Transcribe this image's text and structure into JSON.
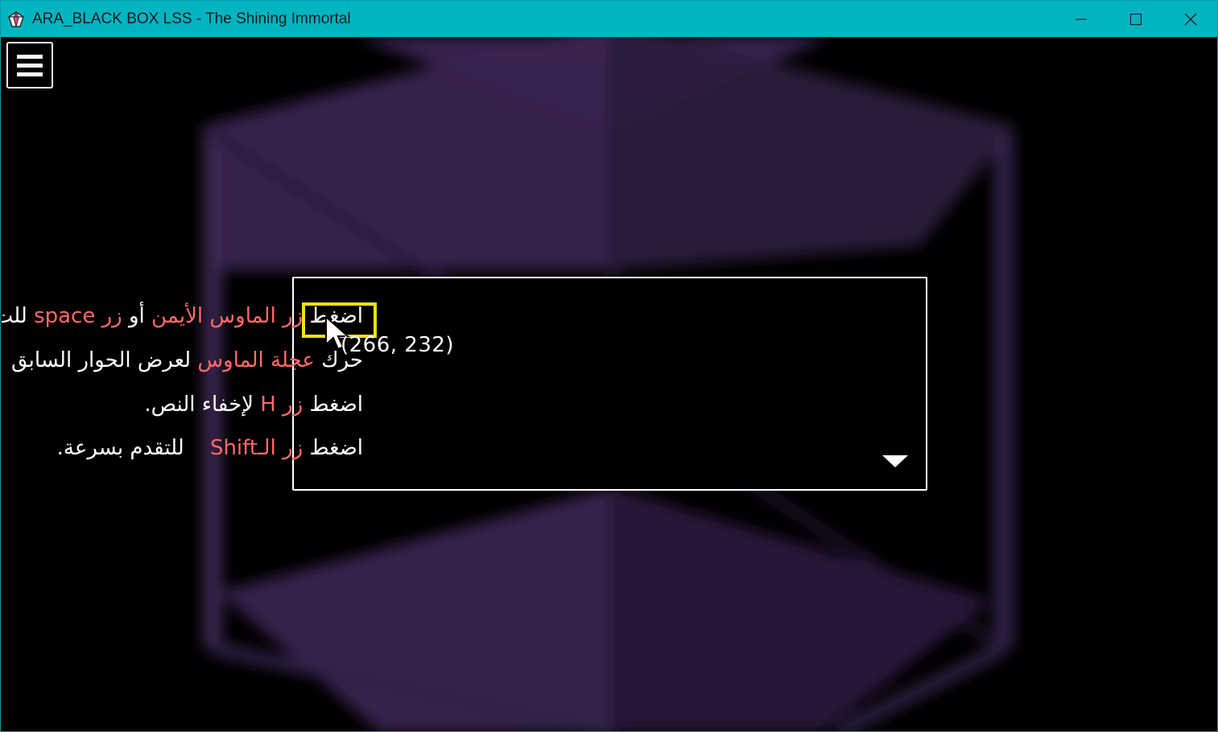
{
  "window": {
    "title": "ARA_BLACK BOX LSS - The Shining Immortal",
    "titlebar_color": "#00b4c2"
  },
  "icons": {
    "app": "app-gem-icon",
    "minimize": "minimize-icon",
    "maximize": "maximize-icon",
    "close": "close-icon",
    "menu": "hamburger-menu-icon",
    "next": "next-arrow-icon",
    "cursor": "mouse-pointer-icon"
  },
  "colors": {
    "background": "#000000",
    "highlight_text": "#ff6a6a",
    "annotation_box": "#f0e20c",
    "art_purple": "#3a2550"
  },
  "instructions": [
    {
      "p1": "اضغط ",
      "h1": "زر الماوس الأيمن",
      "p2": " أو ",
      "h2": "زر space",
      "p3": " للت"
    },
    {
      "p1": "حرك ",
      "h1": "عجلة الماوس",
      "p2": " لعرض الحوار السابق"
    },
    {
      "p1": "اضغط ",
      "h1": "زر H",
      "p2": " لإخفاء النص."
    },
    {
      "p1": "اضغط ",
      "h1": "زر الـShift",
      "p2": " للتقدم بسرعة."
    }
  ],
  "annotation": {
    "coordinates_label": "(266, 232)"
  }
}
